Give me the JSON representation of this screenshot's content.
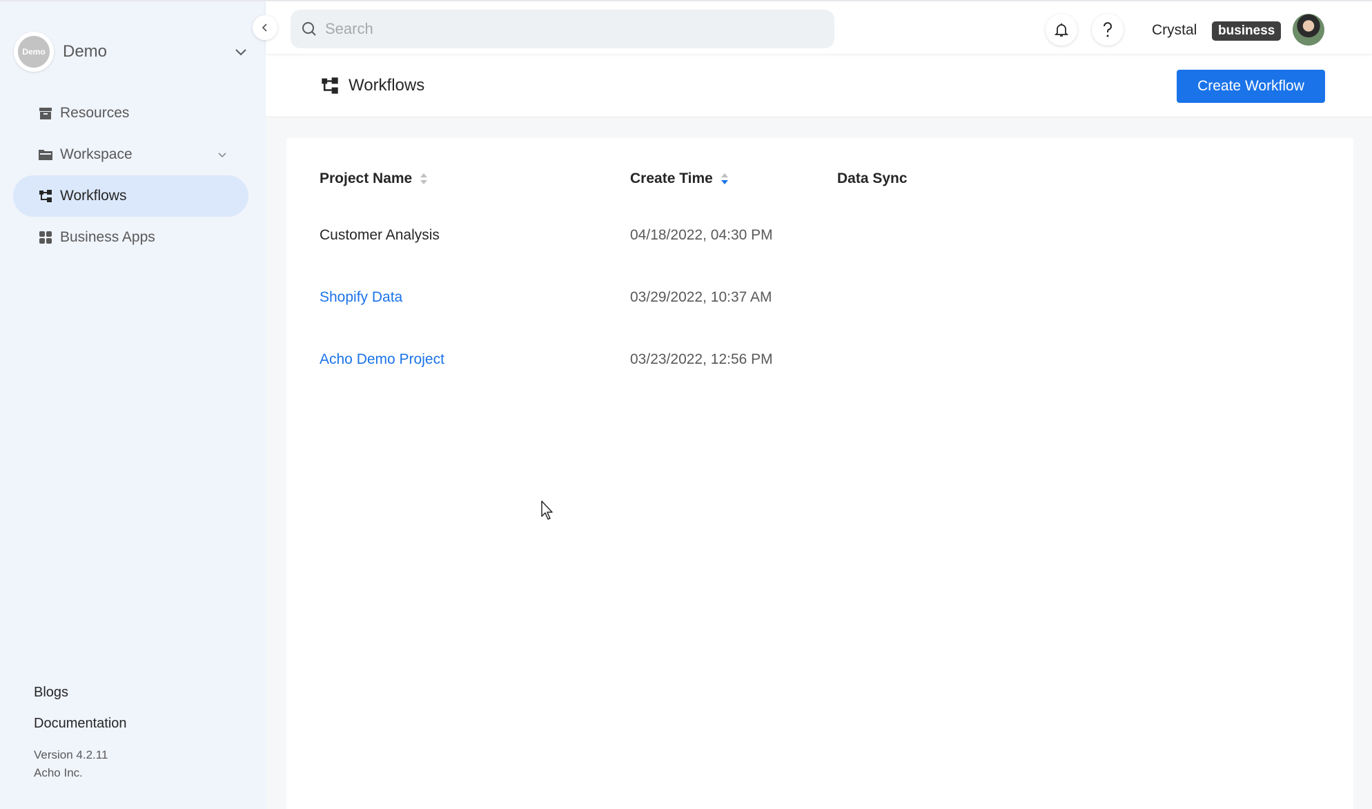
{
  "org": {
    "logo_text": "Demo",
    "name": "Demo"
  },
  "sidebar": {
    "items": [
      {
        "label": "Resources",
        "icon": "archive-icon",
        "active": false
      },
      {
        "label": "Workspace",
        "icon": "folder-icon",
        "active": false,
        "expandable": true
      },
      {
        "label": "Workflows",
        "icon": "workflow-icon",
        "active": true
      },
      {
        "label": "Business Apps",
        "icon": "apps-grid-icon",
        "active": false
      }
    ],
    "footer": {
      "blogs": "Blogs",
      "documentation": "Documentation",
      "version": "Version 4.2.11",
      "company": "Acho Inc."
    }
  },
  "header": {
    "search_placeholder": "Search",
    "user_name": "Crystal",
    "plan": "business"
  },
  "page": {
    "title": "Workflows",
    "create_button": "Create Workflow"
  },
  "table": {
    "columns": [
      "Project Name",
      "Create Time",
      "Data Sync"
    ],
    "rows": [
      {
        "name": "Customer Analysis",
        "created": "04/18/2022, 04:30 PM",
        "link": false
      },
      {
        "name": "Shopify Data",
        "created": "03/29/2022, 10:37 AM",
        "link": true
      },
      {
        "name": "Acho Demo Project",
        "created": "03/23/2022, 12:56 PM",
        "link": true
      }
    ]
  },
  "colors": {
    "accent": "#1a73e8",
    "active_nav_bg": "#dbe8fb",
    "sidebar_bg": "#f0f4fb"
  }
}
